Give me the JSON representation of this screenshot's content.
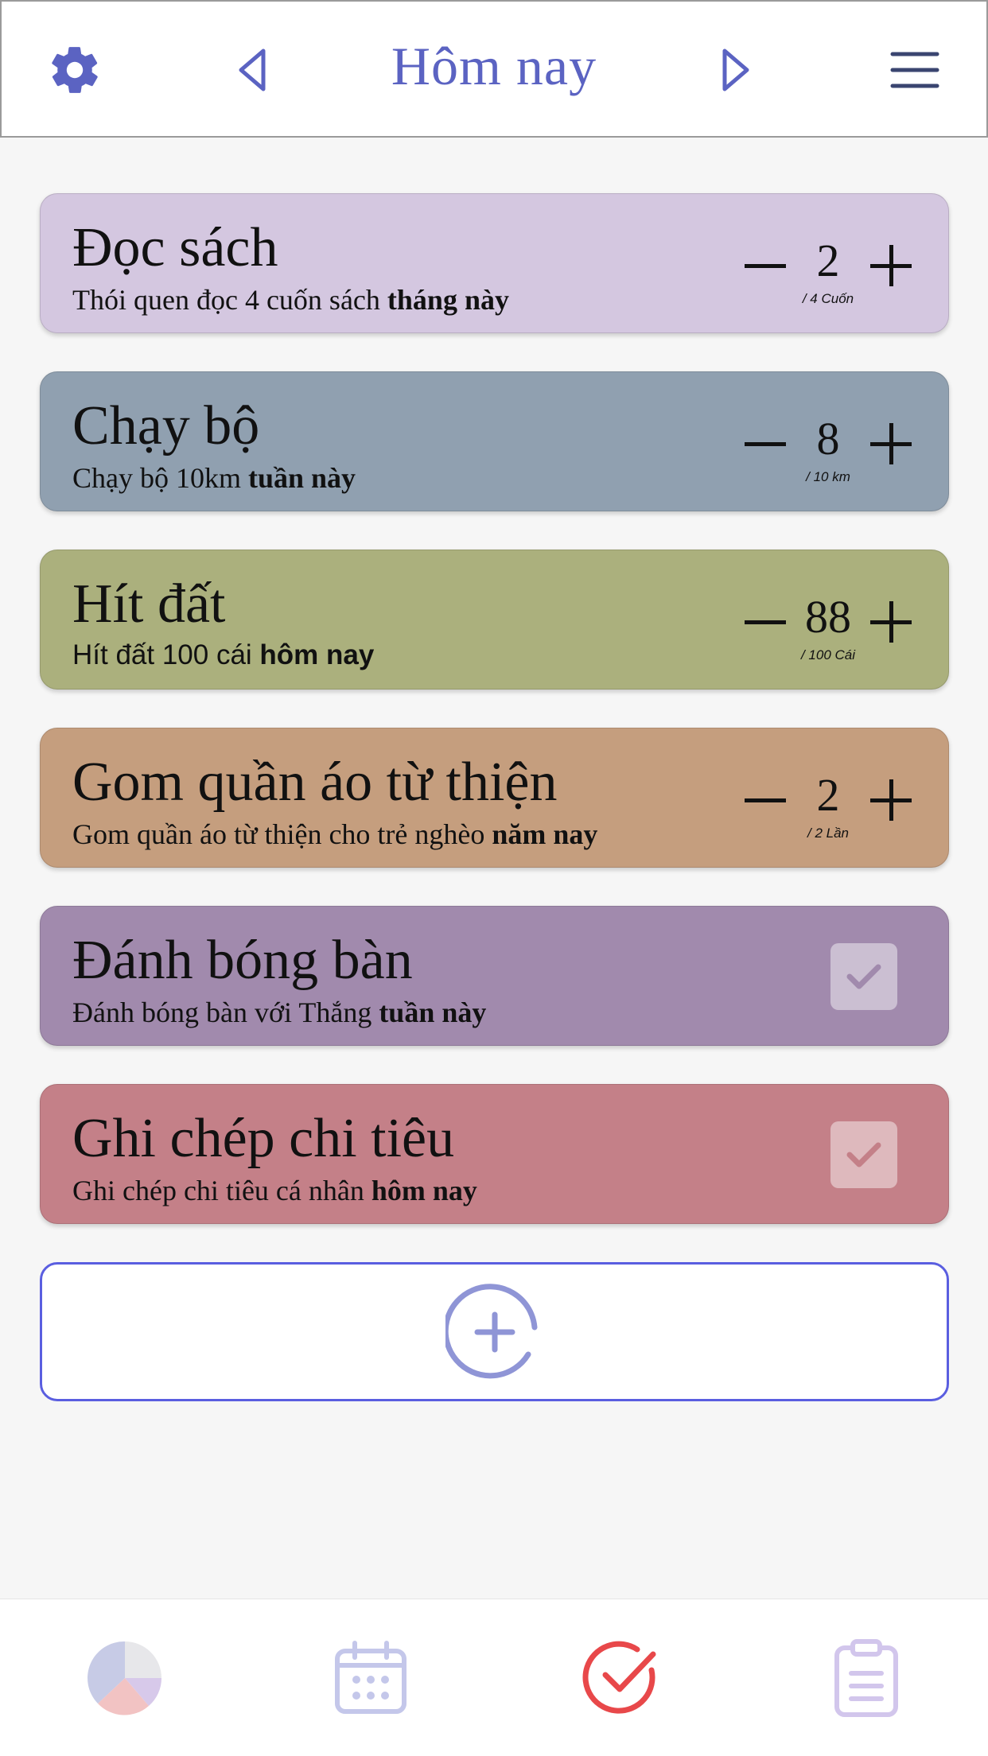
{
  "header": {
    "title": "Hôm nay",
    "settings_icon": "gear-icon",
    "prev_icon": "chevron-left-icon",
    "next_icon": "chevron-right-icon",
    "menu_icon": "hamburger-menu-icon"
  },
  "habits": [
    {
      "title": "Đọc sách",
      "sub_prefix": "Thói quen đọc 4 cuốn sách ",
      "sub_bold": "tháng này",
      "type": "counter",
      "value": "2",
      "unit": "/ 4 Cuốn",
      "color": "#d4c7e0"
    },
    {
      "title": "Chạy bộ",
      "sub_prefix": "Chạy bộ 10km ",
      "sub_bold": "tuần này",
      "type": "counter",
      "value": "8",
      "unit": "/ 10 km",
      "color": "#90a0b0"
    },
    {
      "title": "Hít đất",
      "sub_prefix": "Hít đất 100 cái ",
      "sub_bold": "hôm nay",
      "type": "counter",
      "value": "88",
      "unit": "/ 100 Cái",
      "color": "#abb07d"
    },
    {
      "title": "Gom quần áo từ thiện",
      "sub_prefix": "Gom quần áo từ thiện cho trẻ nghèo ",
      "sub_bold": "năm nay",
      "type": "counter",
      "value": "2",
      "unit": "/ 2 Lần",
      "color": "#c59e7e"
    },
    {
      "title": "Đánh bóng bàn",
      "sub_prefix": "Đánh bóng bàn với Thắng ",
      "sub_bold": "tuần này",
      "type": "check",
      "color": "#a18aad"
    },
    {
      "title": "Ghi chép chi tiêu",
      "sub_prefix": "Ghi chép chi tiêu cá nhân ",
      "sub_bold": "hôm nay",
      "type": "check",
      "color": "#c48088"
    }
  ],
  "add_icon": "add-circle-icon",
  "tabs": [
    {
      "icon": "pie-chart-icon"
    },
    {
      "icon": "calendar-icon"
    },
    {
      "icon": "checkmark-icon",
      "active": true,
      "active_color": "#e8484a"
    },
    {
      "icon": "clipboard-icon"
    }
  ]
}
